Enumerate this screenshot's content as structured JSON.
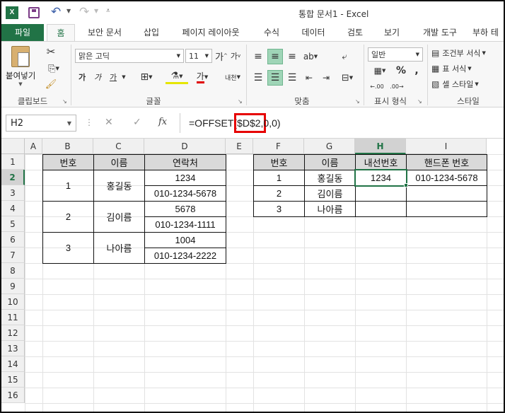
{
  "window": {
    "title": "통합 문서1 - Excel",
    "app_icon": "excel-icon"
  },
  "tabs": [
    {
      "label": "파일",
      "active": false
    },
    {
      "label": "홈",
      "active": true
    },
    {
      "label": "보안 문서"
    },
    {
      "label": "삽입"
    },
    {
      "label": "페이지 레이아웃"
    },
    {
      "label": "수식"
    },
    {
      "label": "데이터"
    },
    {
      "label": "검토"
    },
    {
      "label": "보기"
    },
    {
      "label": "개발 도구"
    },
    {
      "label": "부하 테"
    }
  ],
  "ribbon": {
    "clipboard": {
      "paste": "붙여넣기",
      "group": "클립보드"
    },
    "font": {
      "name": "맑은 고딕",
      "size": "11",
      "group": "글꼴",
      "grow": "가",
      "shrink": "가",
      "bold": "가",
      "italic": "가",
      "underline": "가",
      "fontcolor": "가",
      "phonetic": "내천"
    },
    "align": {
      "group": "맞춤"
    },
    "number": {
      "format": "일반",
      "percent": "%",
      "comma": ",",
      "group": "표시 형식"
    },
    "styles": {
      "conditional": "조건부 서식",
      "table": "표 서식",
      "cell": "셀 스타일",
      "group": "스타일"
    },
    "colors": {
      "accent": "#217346",
      "highlight": "#e60000"
    }
  },
  "formula_bar": {
    "namebox": "H2",
    "fx": "fx",
    "formula_pre": "=OFFSET(",
    "formula_hl": "$D$2,",
    "formula_post": "0,0)"
  },
  "grid": {
    "columns": [
      "A",
      "B",
      "C",
      "D",
      "E",
      "F",
      "G",
      "H",
      "I"
    ],
    "rows": [
      "1",
      "2",
      "3",
      "4",
      "5",
      "6",
      "7",
      "8",
      "9",
      "10",
      "11",
      "12",
      "13",
      "14",
      "15",
      "16"
    ],
    "left_table": {
      "headers": [
        "번호",
        "이름",
        "연락처"
      ],
      "groups": [
        {
          "no": "1",
          "name": "홍길동",
          "ext": "1234",
          "phone": "010-1234-5678"
        },
        {
          "no": "2",
          "name": "김이름",
          "ext": "5678",
          "phone": "010-1234-1111"
        },
        {
          "no": "3",
          "name": "나아름",
          "ext": "1004",
          "phone": "010-1234-2222"
        }
      ]
    },
    "right_table": {
      "headers": [
        "번호",
        "이름",
        "내선번호",
        "핸드폰 번호"
      ],
      "rows": [
        {
          "no": "1",
          "name": "홍길동",
          "ext": "1234",
          "phone": "010-1234-5678"
        },
        {
          "no": "2",
          "name": "김이름",
          "ext": "",
          "phone": ""
        },
        {
          "no": "3",
          "name": "나아름",
          "ext": "",
          "phone": ""
        }
      ]
    },
    "selected_cell": "H2"
  }
}
